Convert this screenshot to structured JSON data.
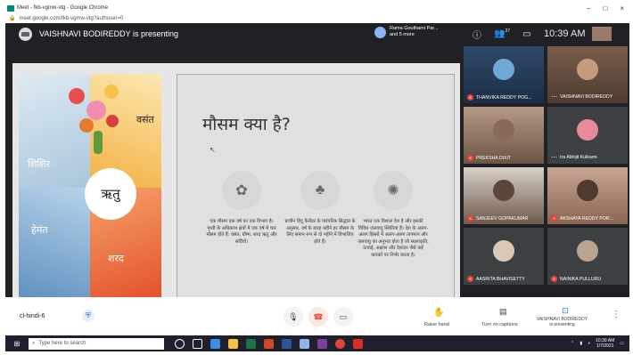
{
  "window": {
    "title": "Meet - fkb-vgmw-vtg - Google Chrome",
    "url": "meet.google.com/fkb-vgmw-vtg?authuser=0",
    "controls": [
      "–",
      "□",
      "×"
    ]
  },
  "meet": {
    "presenter_text": "VAISHNAVI BODIREDDY is presenting",
    "speaker_chip_line1": "Rama Gouthami Par...",
    "speaker_chip_line2": "and 5 more",
    "time": "10:39 AM",
    "participants_count": "37"
  },
  "slide": {
    "seasons": {
      "vasant": "वसंत",
      "shishir": "शिशिर",
      "hemant": "हेमंत",
      "sharad": "शरद",
      "center": "ऋतु"
    },
    "title": "मौसम क्या है?",
    "columns": [
      {
        "icon": "plant-icon",
        "glyph": "✿",
        "text": "एक मौसम एक वर्ष का एक विभाग है। पृथ्वी के अधिकांश क्षेत्रों में एक वर्ष में चार मौसम होते हैं: वसंत, ग्रीष्म, शरद ऋतु और सर्दियाँ।"
      },
      {
        "icon": "tree-icon",
        "glyph": "♣",
        "text": "प्राचीन हिंदू कैलेंडर के पारंपरिक सिद्धांत के अनुसार, वर्ष के बारह महीने हर मौसम के लिए समान रूप से दो महीने में विभाजित होते हैं।"
      },
      {
        "icon": "bee-icon",
        "glyph": "✺",
        "text": "भारत एक विशाल देश है और इसकी विविध जलवायु स्थितियां हैं। देश के अलग-अलग हिस्सों में अलग-अलग तापमान और जलवायु का अनुभव होता है जो स्थलाकृति, ऊंचाई, अक्षांश और देशांतर जैसे कई कारकों पर निर्भर करता है।"
      }
    ]
  },
  "tiles": [
    {
      "name": "THANVIKA REDDY POG...",
      "muted": true,
      "dots": false
    },
    {
      "name": "VAISHNAVI BODIREDDY",
      "muted": false,
      "dots": true
    },
    {
      "name": "PREKSHA DIXIT",
      "muted": true,
      "dots": false
    },
    {
      "name": "Ira Abhijit Kulkarni",
      "muted": false,
      "dots": true
    },
    {
      "name": "SANJEEV GOPAKUMAR",
      "muted": true,
      "dots": false
    },
    {
      "name": "AKSHAYA REDDY POR...",
      "muted": true,
      "dots": false
    },
    {
      "name": "AASRITA BHAVISETTY",
      "muted": true,
      "dots": false
    },
    {
      "name": "NAINIKA PULLURU",
      "muted": true,
      "dots": false
    }
  ],
  "controls": {
    "meeting_code": "cl-hindi-6",
    "raise_hand": "Raise hand",
    "captions": "Turn on captions",
    "presenting_line1": "VAISHNAVI BODIREDDY",
    "presenting_line2": "is presenting"
  },
  "taskbar": {
    "search_placeholder": "Type here to search",
    "clock_time": "10:39 AM",
    "clock_date": "1/7/2021"
  }
}
